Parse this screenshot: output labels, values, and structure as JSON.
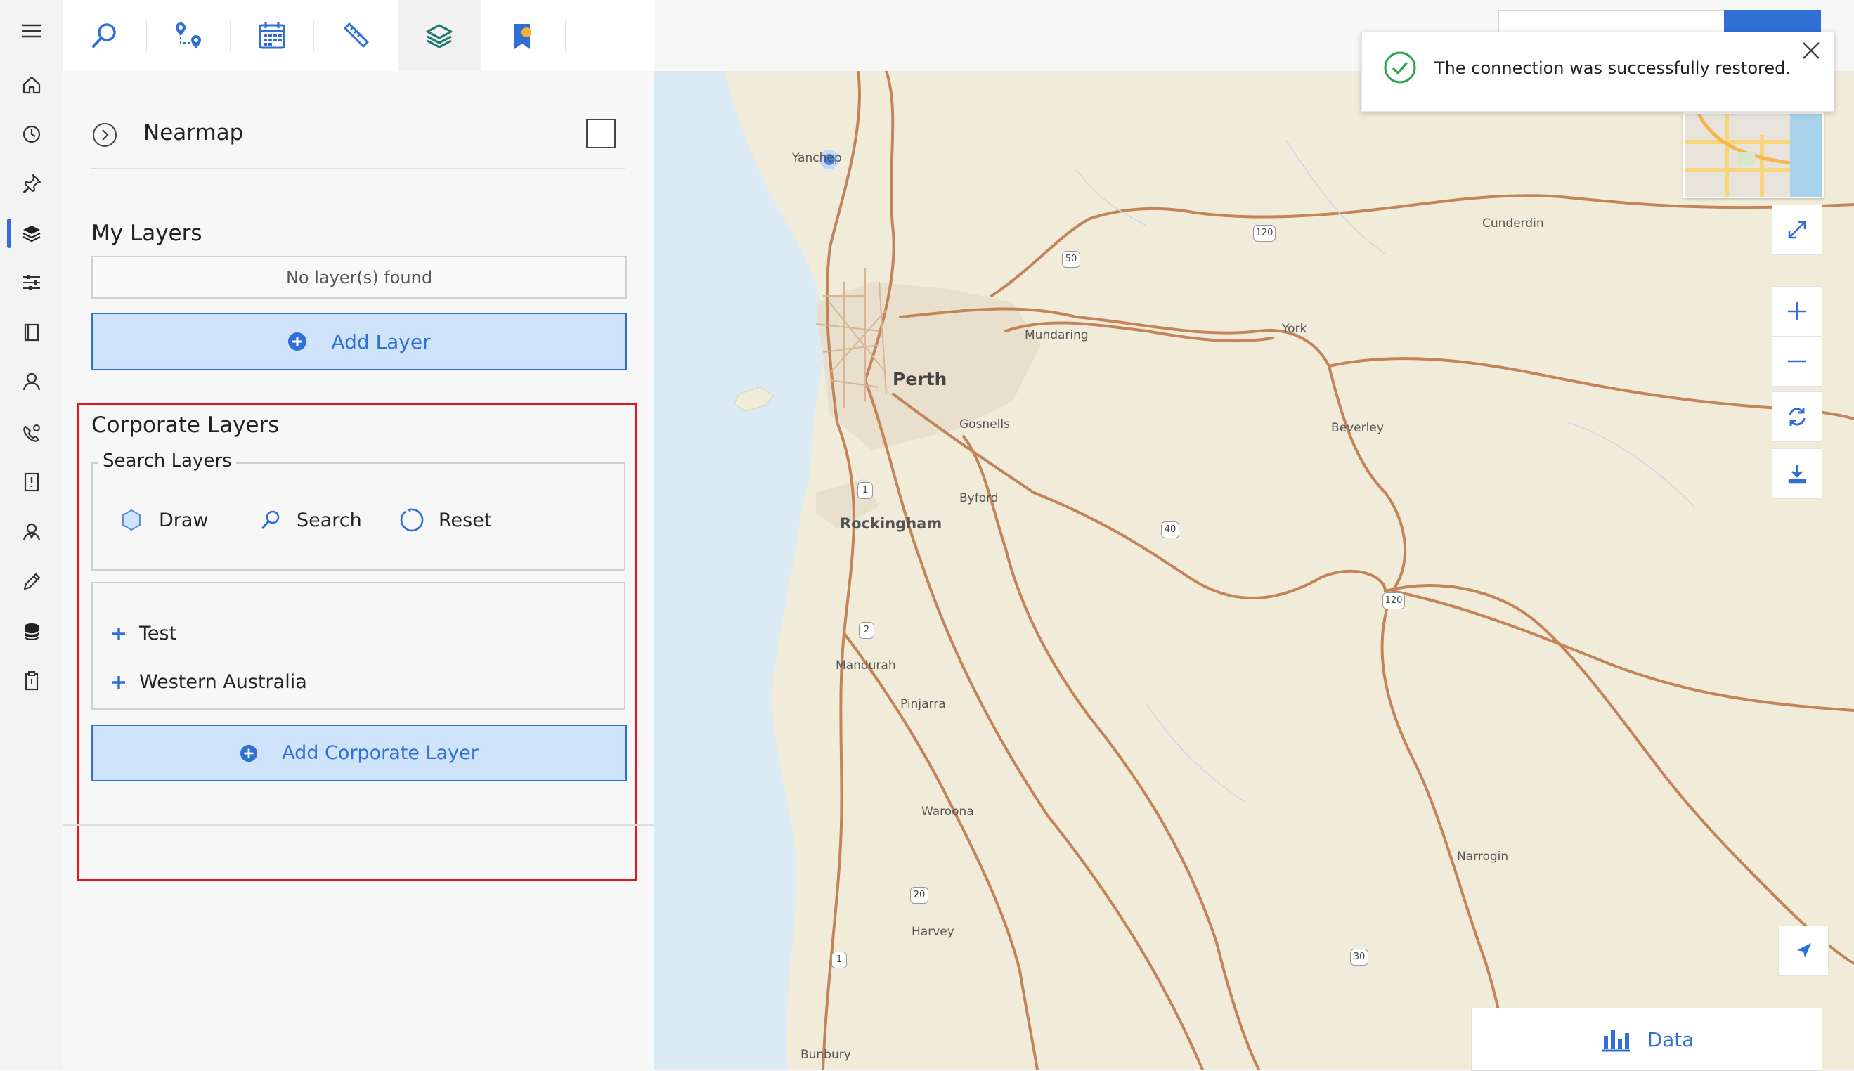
{
  "rail": {
    "icons": [
      "menu-icon",
      "home-icon",
      "history-icon",
      "pin-icon",
      "layers-icon",
      "filters-icon",
      "book-icon",
      "user-icon",
      "support-icon",
      "report-icon",
      "contact-icon",
      "pencil-icon",
      "database-icon",
      "clipboard-icon"
    ],
    "active_index": 4
  },
  "toolbar": {
    "tools": [
      "search-tool-icon",
      "route-tool-icon",
      "calendar-tool-icon",
      "measure-tool-icon",
      "layers-tool-icon",
      "bookmark-tool-icon"
    ],
    "active_index": 4
  },
  "panel": {
    "nearmap": {
      "label": "Nearmap",
      "checked": false
    },
    "my_layers": {
      "title": "My Layers",
      "empty_text": "No layer(s) found",
      "add_button": "Add Layer"
    },
    "corporate_layers": {
      "title": "Corporate Layers",
      "search_legend": "Search Layers",
      "draw_label": "Draw",
      "search_label": "Search",
      "reset_label": "Reset",
      "tree": [
        {
          "label": "Test"
        },
        {
          "label": "Western Australia"
        }
      ],
      "add_button": "Add Corporate Layer"
    }
  },
  "notification": {
    "message": "The connection was successfully restored."
  },
  "map": {
    "labels": {
      "yanchep": "Yanchep",
      "perth": "Perth",
      "mundaring": "Mundaring",
      "gosnells": "Gosnells",
      "byford": "Byford",
      "rockingham": "Rockingham",
      "mandurah": "Mandurah",
      "pinjarra": "Pinjarra",
      "waroona": "Waroona",
      "harvey": "Harvey",
      "bunbury": "Bunbury",
      "cunderdin": "Cunderdin",
      "york": "York",
      "beverley": "Beverley",
      "narrogin": "Narrogin"
    },
    "shields": {
      "s50": "50",
      "s120a": "120",
      "s120b": "120",
      "s40": "40",
      "s1a": "1",
      "s2": "2",
      "s20": "20",
      "s1b": "1",
      "s30": "30"
    },
    "data_button": "Data"
  },
  "colors": {
    "accent": "#2f6fd6",
    "button_fill": "#cfe3fb",
    "highlight_box": "#e0161d",
    "success": "#2aa84a",
    "water": "#dbeaf3",
    "land": "#f1ecd9",
    "road": "#c4845a"
  }
}
